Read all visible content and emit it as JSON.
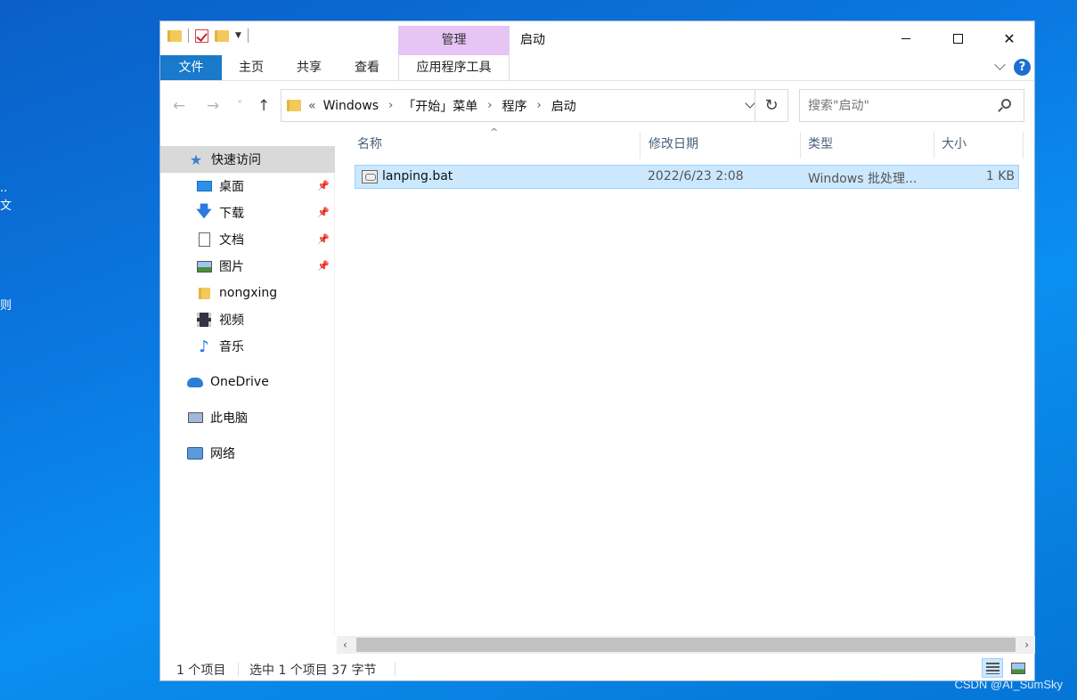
{
  "desktop": {
    "fragments": [
      "..",
      "文",
      "则"
    ],
    "watermark": "CSDN @AI_SumSky"
  },
  "titlebar": {
    "context_tab_header": "管理",
    "window_title": "启动",
    "minimize_glyph": "",
    "close_glyph": "✕"
  },
  "ribbon": {
    "tabs": [
      "文件",
      "主页",
      "共享",
      "查看",
      "应用程序工具"
    ],
    "help_glyph": "?"
  },
  "nav": {
    "back_glyph": "←",
    "forward_glyph": "→",
    "recent_glyph": "˅",
    "up_glyph": "↑",
    "overflow": "«",
    "breadcrumbs": [
      "Windows",
      "「开始」菜单",
      "程序",
      "启动"
    ],
    "crumb_separator": "›",
    "refresh_glyph": "↻",
    "search_placeholder": "搜索\"启动\""
  },
  "sidebar": {
    "quick_access": "快速访问",
    "items": [
      {
        "label": "桌面",
        "icon": "desktop-icon",
        "pinned": true
      },
      {
        "label": "下载",
        "icon": "download-icon",
        "pinned": true
      },
      {
        "label": "文档",
        "icon": "document-icon",
        "pinned": true
      },
      {
        "label": "图片",
        "icon": "pictures-icon",
        "pinned": true
      },
      {
        "label": "nongxing",
        "icon": "folder-icon",
        "pinned": false
      },
      {
        "label": "视频",
        "icon": "video-icon",
        "pinned": false
      },
      {
        "label": "音乐",
        "icon": "music-icon",
        "pinned": false
      }
    ],
    "onedrive": "OneDrive",
    "this_pc": "此电脑",
    "network": "网络",
    "pin_glyph": "📌"
  },
  "content": {
    "columns": [
      "名称",
      "修改日期",
      "类型",
      "大小"
    ],
    "sort_indicator": "^",
    "files": [
      {
        "name": "lanping.bat",
        "modified": "2022/6/23 2:08",
        "type": "Windows 批处理...",
        "size": "1 KB",
        "selected": true
      }
    ]
  },
  "scroll": {
    "left": "‹",
    "right": "›"
  },
  "status": {
    "item_count": "1 个项目",
    "selection": "选中 1 个项目  37 字节"
  },
  "colors": {
    "file_tab": "#1979ca",
    "context_tab": "#e6c5f5",
    "selection": "#cce8ff",
    "selection_border": "#99d1ff"
  }
}
